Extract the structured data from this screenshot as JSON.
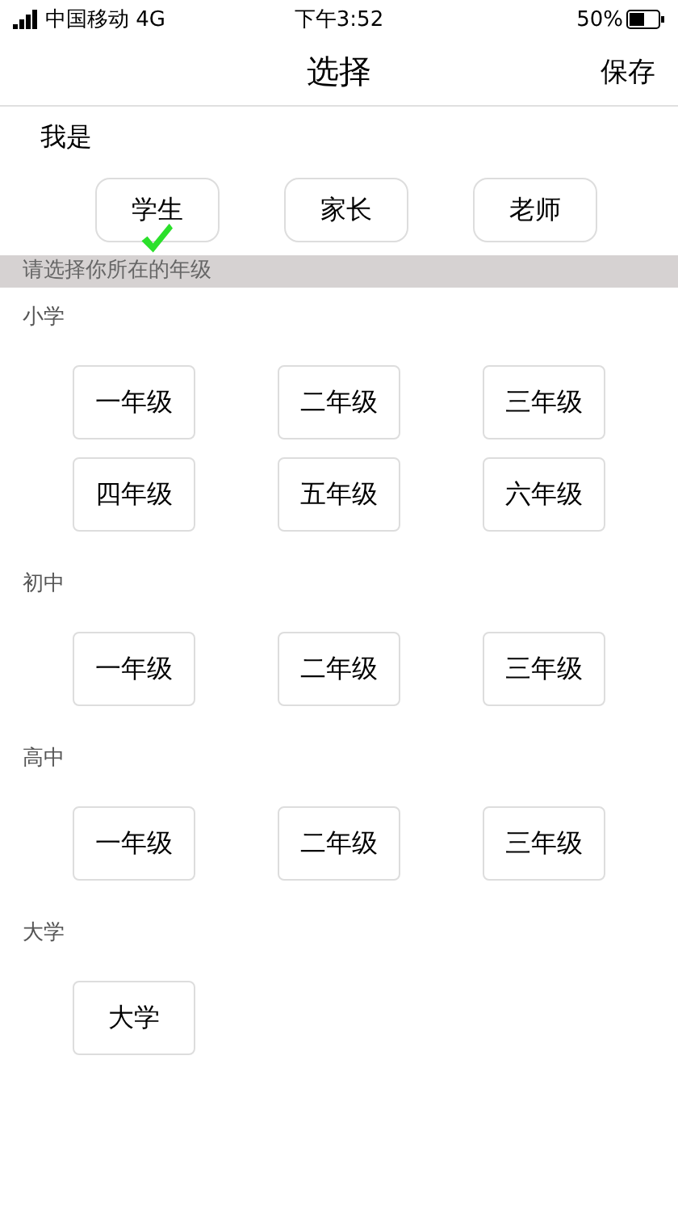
{
  "status_bar": {
    "carrier": "中国移动 4G",
    "time": "下午3:52",
    "battery": "50%"
  },
  "nav": {
    "title": "选择",
    "action": "保存"
  },
  "role": {
    "label": "我是",
    "options": [
      {
        "label": "学生",
        "selected": true
      },
      {
        "label": "家长",
        "selected": false
      },
      {
        "label": "老师",
        "selected": false
      }
    ]
  },
  "prompt": "请选择你所在的年级",
  "sections": [
    {
      "title": "小学",
      "grades": [
        "一年级",
        "二年级",
        "三年级",
        "四年级",
        "五年级",
        "六年级"
      ]
    },
    {
      "title": "初中",
      "grades": [
        "一年级",
        "二年级",
        "三年级"
      ]
    },
    {
      "title": "高中",
      "grades": [
        "一年级",
        "二年级",
        "三年级"
      ]
    },
    {
      "title": "大学",
      "grades": [
        "大学"
      ]
    }
  ]
}
